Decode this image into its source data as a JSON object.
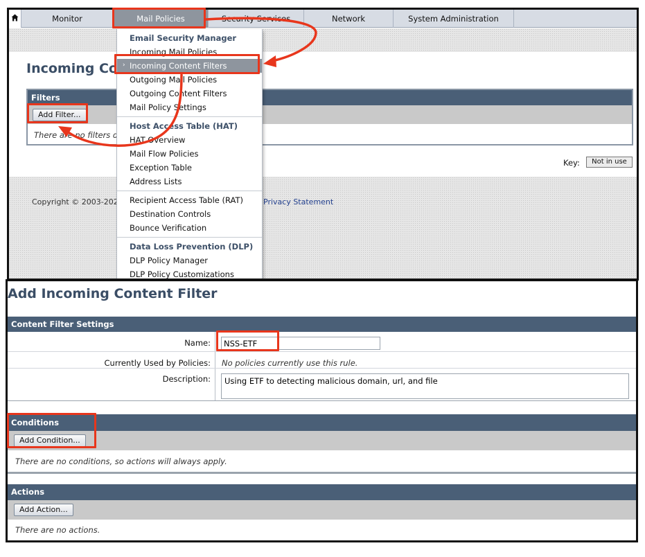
{
  "nav": {
    "home_icon": "home-icon",
    "items": [
      "Monitor",
      "Mail Policies",
      "Security Services",
      "Network",
      "System Administration"
    ]
  },
  "top_page": {
    "title": "Incoming Co",
    "filters_header": "Filters",
    "add_filter_label": "Add Filter...",
    "empty_text": "There are no filters de",
    "key_label": "Key:",
    "key_value": "Not in use",
    "copyright": "Copyright © 2003-2023",
    "privacy_link": "Privacy Statement"
  },
  "dropdown": {
    "groups": [
      {
        "header": "Email Security Manager",
        "items": [
          "Incoming Mail Policies",
          "Incoming Content Filters",
          "Outgoing Mail Policies",
          "Outgoing Content Filters",
          "Mail Policy Settings"
        ]
      },
      {
        "header": "Host Access Table (HAT)",
        "items": [
          "HAT Overview",
          "Mail Flow Policies",
          "Exception Table",
          "Address Lists"
        ]
      },
      {
        "header": "",
        "items": [
          "Recipient Access Table (RAT)",
          "Destination Controls",
          "Bounce Verification"
        ]
      },
      {
        "header": "Data Loss Prevention (DLP)",
        "items": [
          "DLP Policy Manager",
          "DLP Policy Customizations"
        ]
      }
    ],
    "selected": "Incoming Content Filters"
  },
  "form": {
    "title": "Add Incoming Content Filter",
    "settings_header": "Content Filter Settings",
    "name_label": "Name:",
    "name_value": "NSS-ETF",
    "used_by_label": "Currently Used by Policies:",
    "used_by_value": "No policies currently use this rule.",
    "description_label": "Description:",
    "description_value": "Using ETF to detecting malicious domain, url, and file",
    "conditions_header": "Conditions",
    "add_condition_label": "Add Condition...",
    "conditions_empty": "There are no conditions, so actions will always apply.",
    "actions_header": "Actions",
    "add_action_label": "Add Action...",
    "actions_empty": "There are no actions."
  },
  "annotation_color": "#e8361c"
}
